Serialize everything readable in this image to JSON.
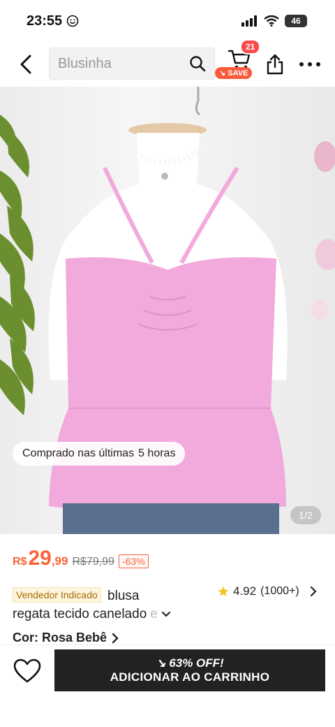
{
  "status": {
    "time": "23:55",
    "battery": "46"
  },
  "search": {
    "placeholder": "Blusinha"
  },
  "cart": {
    "count": "21",
    "save_label": "SAVE"
  },
  "gallery": {
    "recent_purchase": "Comprado nas últimas",
    "recent_hours": "5 horas",
    "page": "1/2"
  },
  "price": {
    "currency": "R$",
    "integer": "29",
    "decimal": ",99",
    "original": "R$79,99",
    "discount": "-63%"
  },
  "product": {
    "seller_tag": "Vendedor Indicado",
    "title_line1": "blusa",
    "title_line2": "regata tecido canelado",
    "title_fade": "e",
    "rating": "4.92",
    "rating_count": "(1000+)"
  },
  "color": {
    "label": "Cor: Rosa Bebê"
  },
  "bottom": {
    "promo": "63% OFF!",
    "add_to_cart": "ADICIONAR AO CARRINHO"
  },
  "colors": {
    "accent": "#fa6338",
    "badge_red": "#fa4b4b",
    "button_dark": "#222222",
    "product_pink": "#f2a9dc"
  }
}
